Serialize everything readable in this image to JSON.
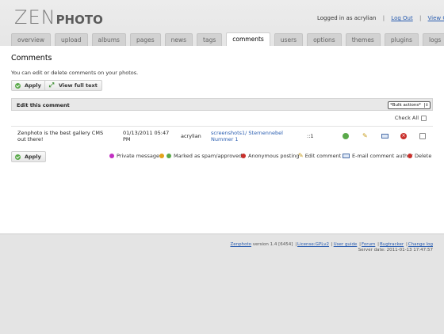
{
  "brand": {
    "zen": "ZEN",
    "photo": "PHOTO"
  },
  "userbar": {
    "logged_in": "Logged in as acrylian",
    "logout": "Log Out",
    "view_gallery": "View Gallery",
    "sep": "|"
  },
  "tabs": [
    {
      "label": "overview",
      "active": false
    },
    {
      "label": "upload",
      "active": false
    },
    {
      "label": "albums",
      "active": false
    },
    {
      "label": "pages",
      "active": false
    },
    {
      "label": "news",
      "active": false
    },
    {
      "label": "tags",
      "active": false
    },
    {
      "label": "comments",
      "active": true
    },
    {
      "label": "users",
      "active": false
    },
    {
      "label": "options",
      "active": false
    },
    {
      "label": "themes",
      "active": false
    },
    {
      "label": "plugins",
      "active": false
    },
    {
      "label": "logs",
      "active": false
    }
  ],
  "page": {
    "title": "Comments",
    "intro": "You can edit or delete comments on your photos.",
    "apply_label": "Apply",
    "view_full_text_label": "View full text"
  },
  "table": {
    "header": "Edit this comment",
    "bulk_select": "*Bulk actions*",
    "check_all": "Check All",
    "rows": [
      {
        "comment": "Zenphoto is the best gallery CMS out there!",
        "date": "01/13/2011 05:47 PM",
        "author": "acrylian",
        "item_line1": "screenshots1/ Sternennebel",
        "item_line2": "Nummer 1",
        "ip": "::1"
      }
    ]
  },
  "legend": [
    {
      "label": "Private message",
      "icon": "private-icon",
      "color": "#c22fc2"
    },
    {
      "label": "Marked as spam/approved",
      "icon": "spam-approved-icon",
      "color": "#e3a21a"
    },
    {
      "label": "Anonymous posting",
      "icon": "anonymous-icon",
      "color": "#c9302c"
    },
    {
      "label": "Edit comment",
      "icon": "pencil-icon",
      "color": "#c59a1a"
    },
    {
      "label": "E-mail comment author",
      "icon": "mail-icon",
      "color": "#4a6ea8"
    },
    {
      "label": "Delete",
      "icon": "delete-icon",
      "color": "#c9302c"
    }
  ],
  "footer": {
    "brand": "Zenphoto",
    "version": "version 1.4 [6454]",
    "license": "License:GPLv2",
    "user_guide": "User guide",
    "forum": "Forum",
    "bugtracker": "Bugtracker",
    "changelog": "Change log",
    "server_date": "Server date: 2011-01-13 17:47:57"
  }
}
